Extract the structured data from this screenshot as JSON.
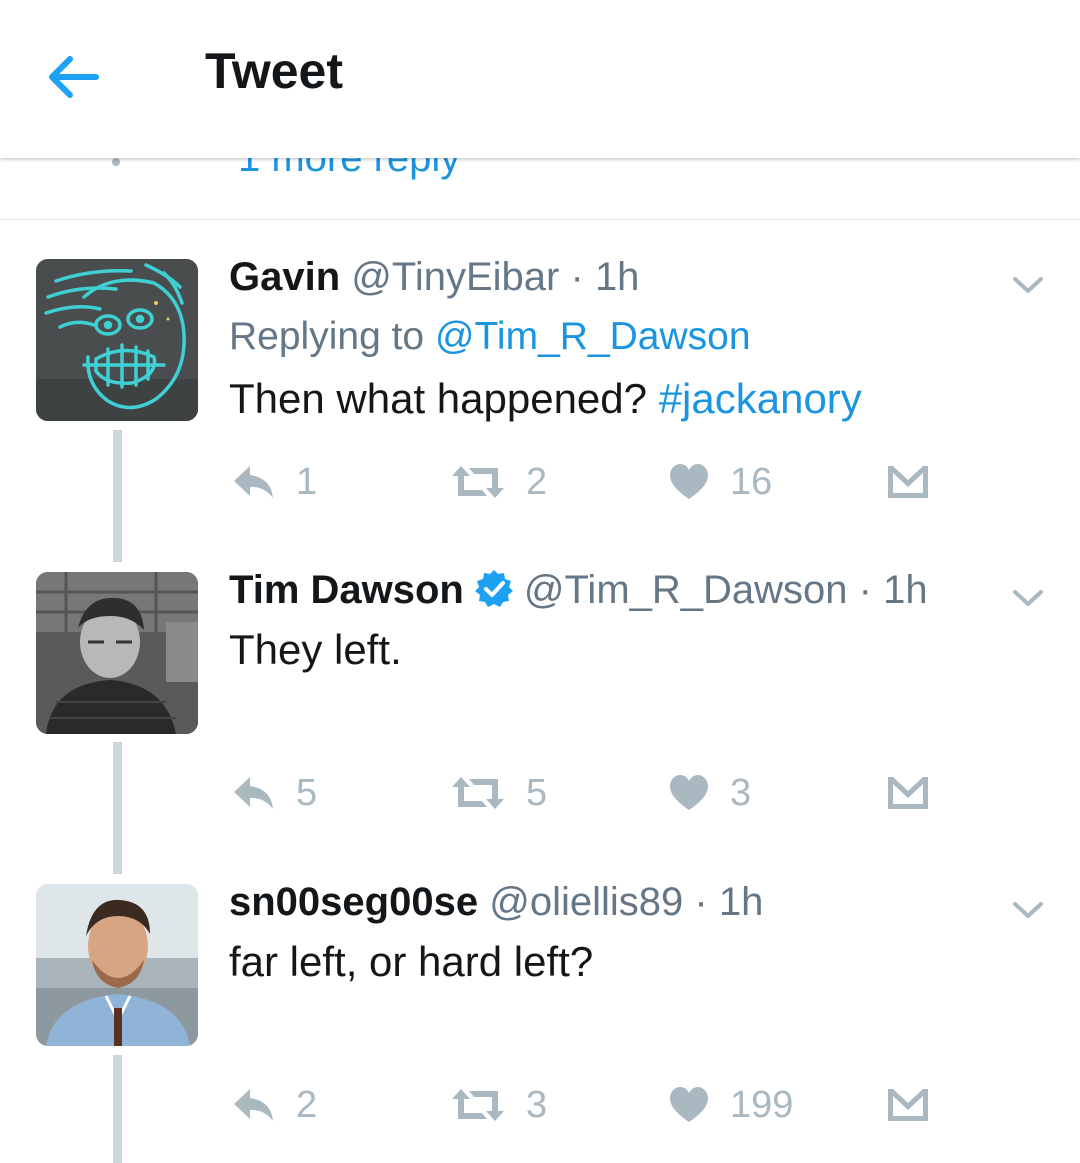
{
  "header": {
    "title": "Tweet"
  },
  "peek": {
    "text": "1 more reply"
  },
  "tweets": [
    {
      "name": "Gavin",
      "handle": "@TinyEibar",
      "separator": "·",
      "time": "1h",
      "replying_label": "Replying to",
      "replying_to": "@Tim_R_Dawson",
      "text": "Then what happened?",
      "hashtag": "#jackanory",
      "replies": "1",
      "retweets": "2",
      "likes": "16"
    },
    {
      "name": "Tim Dawson",
      "verified": true,
      "handle": "@Tim_R_Dawson",
      "separator": "·",
      "time": "1h",
      "text": "They left.",
      "replies": "5",
      "retweets": "5",
      "likes": "3"
    },
    {
      "name": "sn00seg00se",
      "handle": "@oliellis89",
      "separator": "·",
      "time": "1h",
      "text": "far left, or hard left?",
      "replies": "2",
      "retweets": "3",
      "likes": "199"
    }
  ],
  "colors": {
    "accent": "#1da1f2",
    "link": "#1b95e0",
    "secondary_text": "#657786",
    "action_icon": "#aab8c2",
    "thread_line": "#ccd6dd"
  },
  "icons": {
    "back": "arrow-left-icon",
    "caret": "chevron-down-icon",
    "reply": "reply-icon",
    "retweet": "retweet-icon",
    "like": "heart-icon",
    "dm": "envelope-icon",
    "verified": "verified-badge-icon"
  }
}
